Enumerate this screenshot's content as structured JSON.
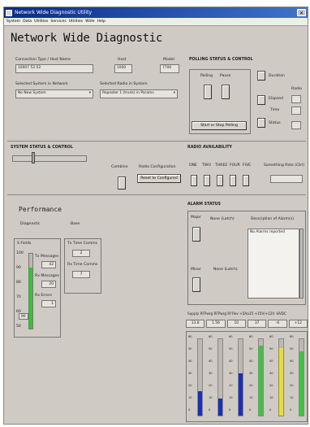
{
  "window": {
    "title": "Network Wide Diagnostic Utility"
  },
  "menu": [
    "System",
    "Data",
    "Utilities",
    "Services",
    "Utilities",
    "Wide",
    "Help"
  ],
  "header": {
    "title": "Network Wide Diagnostic"
  },
  "top": {
    "conn_label": "Connection Type / Host Name",
    "conn_value": "10007 53 53",
    "host_label": "Host",
    "host_value": "1000",
    "model_label": "Model",
    "model_value": "7700",
    "sel_system_label": "Selected System in Network",
    "sel_system_value": "No New System",
    "sel_radio_label": "Selected Radio in System",
    "sel_radio_value": "Repeater 1 (trunk) in Params"
  },
  "polling": {
    "title": "POLLING STATUS & CONTROL",
    "polling": "Polling",
    "pause": "Pause",
    "duration": "Duration",
    "elapsed": "Elapsed",
    "time": "Time",
    "status": "Status",
    "radio": "Radio",
    "start_stop": "Start or Stop Polling"
  },
  "system": {
    "title": "SYSTEM STATUS & CONTROL",
    "combine": "Combine",
    "radio_config": "Radio Configuration",
    "reset": "Reset to Configured"
  },
  "radio_availability": {
    "title": "RADIO AVAILABILITY",
    "cols": [
      "ONE",
      "TWO",
      "THREE",
      "FOUR",
      "FIVE"
    ],
    "extra": "Something Rate (Ctrl)"
  },
  "alarm": {
    "title": "ALARM STATUS",
    "major": "Major",
    "minor": "Minor",
    "none1": "None (Latch)",
    "none2": "None (Latch)",
    "desc": "Description of Alarm(s)",
    "desc_value": "No Alarms reported"
  },
  "performance": {
    "title": "Performance",
    "diagnostic": "Diagnostic",
    "base": "Base",
    "s_fields": "S Fields",
    "value_90": "90",
    "tx_messages": "Tx Messages",
    "tx_messages_val": "42",
    "rx_messages": "Rx Messages",
    "rx_messages_val": "20",
    "rx_errors": "Rx Errors",
    "rx_errors_val": "1",
    "tx_time_comms": "Tx Time Comms",
    "tx_time_comms_val": "2",
    "rx_time_comms": "Rx Time Comms",
    "rx_time_comms_val": "7",
    "scale": [
      "100",
      "90",
      "80",
      "70",
      "60",
      "50"
    ],
    "level_fraction": 0.82
  },
  "signal": {
    "header": "Supply RFPwrg RFPwrg Rf Rev +5Aa15 +15V/+12V -8VDC",
    "values": [
      "13.8",
      "1.56",
      "10",
      "37",
      "-6",
      "+12"
    ],
    "scale": [
      "60",
      "50",
      "40",
      "30",
      "20",
      "10",
      "0"
    ],
    "fractions": [
      0.32,
      0.22,
      0.55,
      0.92,
      0.88,
      0.84
    ],
    "colors": [
      "#1c2fb8",
      "#1c2fb8",
      "#1c2fb8",
      "#3cc43c",
      "#e8e028",
      "#3cc43c"
    ]
  }
}
